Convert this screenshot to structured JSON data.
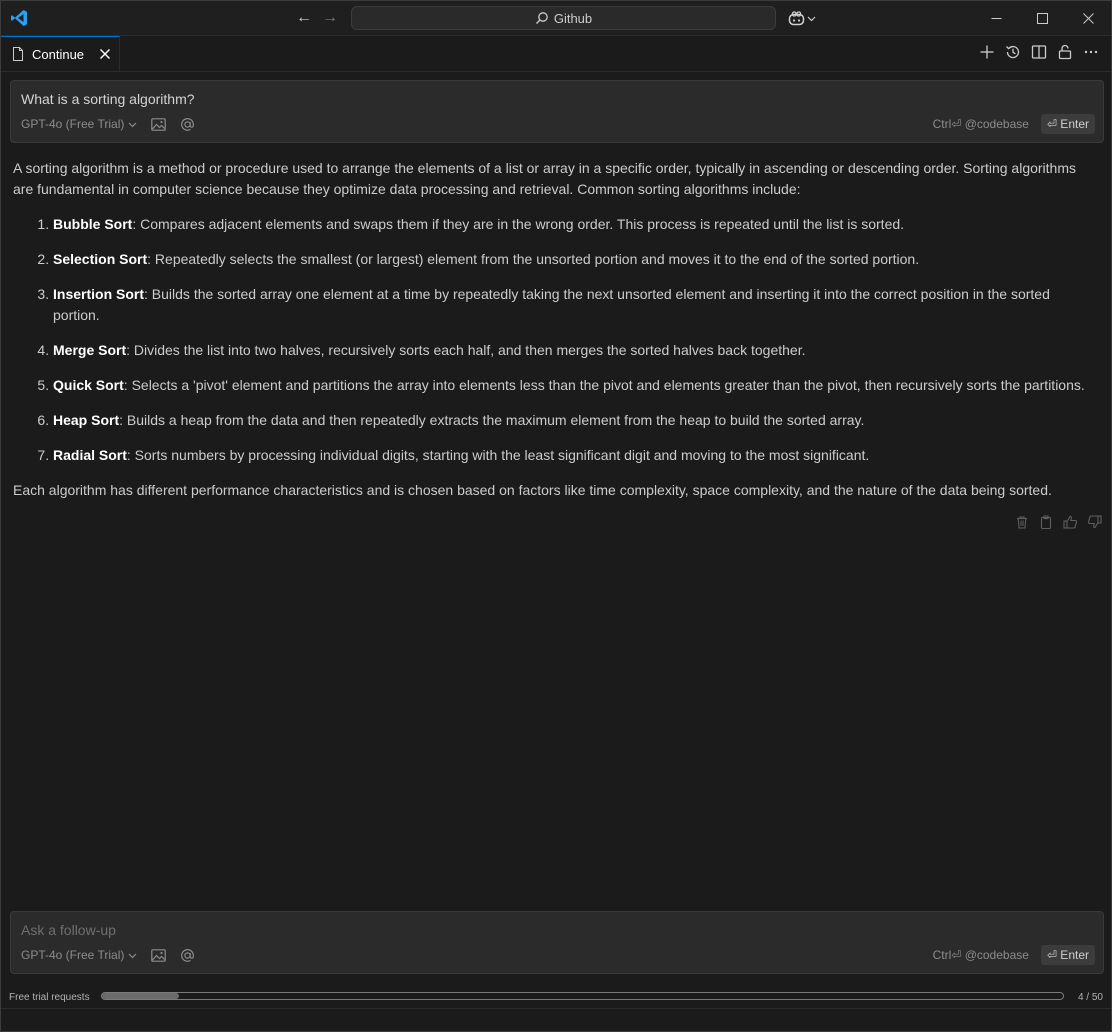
{
  "titlebar": {
    "search_label": "Github",
    "accent_color": "#0078d4"
  },
  "tab": {
    "label": "Continue"
  },
  "top_input": {
    "text": "What is a sorting algorithm?",
    "model": "GPT-4o (Free Trial)",
    "codebase_hint": "Ctrl⏎ @codebase",
    "enter_label": "⏎ Enter"
  },
  "response": {
    "intro": "A sorting algorithm is a method or procedure used to arrange the elements of a list or array in a specific order, typically in ascending or descending order. Sorting algorithms are fundamental in computer science because they optimize data processing and retrieval. Common sorting algorithms include:",
    "items": [
      {
        "name": "Bubble Sort",
        "desc": ": Compares adjacent elements and swaps them if they are in the wrong order. This process is repeated until the list is sorted."
      },
      {
        "name": "Selection Sort",
        "desc": ": Repeatedly selects the smallest (or largest) element from the unsorted portion and moves it to the end of the sorted portion."
      },
      {
        "name": "Insertion Sort",
        "desc": ": Builds the sorted array one element at a time by repeatedly taking the next unsorted element and inserting it into the correct position in the sorted portion."
      },
      {
        "name": "Merge Sort",
        "desc": ": Divides the list into two halves, recursively sorts each half, and then merges the sorted halves back together."
      },
      {
        "name": "Quick Sort",
        "desc": ": Selects a 'pivot' element and partitions the array into elements less than the pivot and elements greater than the pivot, then recursively sorts the partitions."
      },
      {
        "name": "Heap Sort",
        "desc": ": Builds a heap from the data and then repeatedly extracts the maximum element from the heap to build the sorted array."
      },
      {
        "name": "Radial Sort",
        "desc": ": Sorts numbers by processing individual digits, starting with the least significant digit and moving to the most significant."
      }
    ],
    "outro": "Each algorithm has different performance characteristics and is chosen based on factors like time complexity, space complexity, and the nature of the data being sorted."
  },
  "bottom_input": {
    "placeholder": "Ask a follow-up",
    "model": "GPT-4o (Free Trial)",
    "codebase_hint": "Ctrl⏎ @codebase",
    "enter_label": "⏎ Enter"
  },
  "trial": {
    "label": "Free trial requests",
    "used": 4,
    "total": 50,
    "count_text": "4 / 50"
  }
}
